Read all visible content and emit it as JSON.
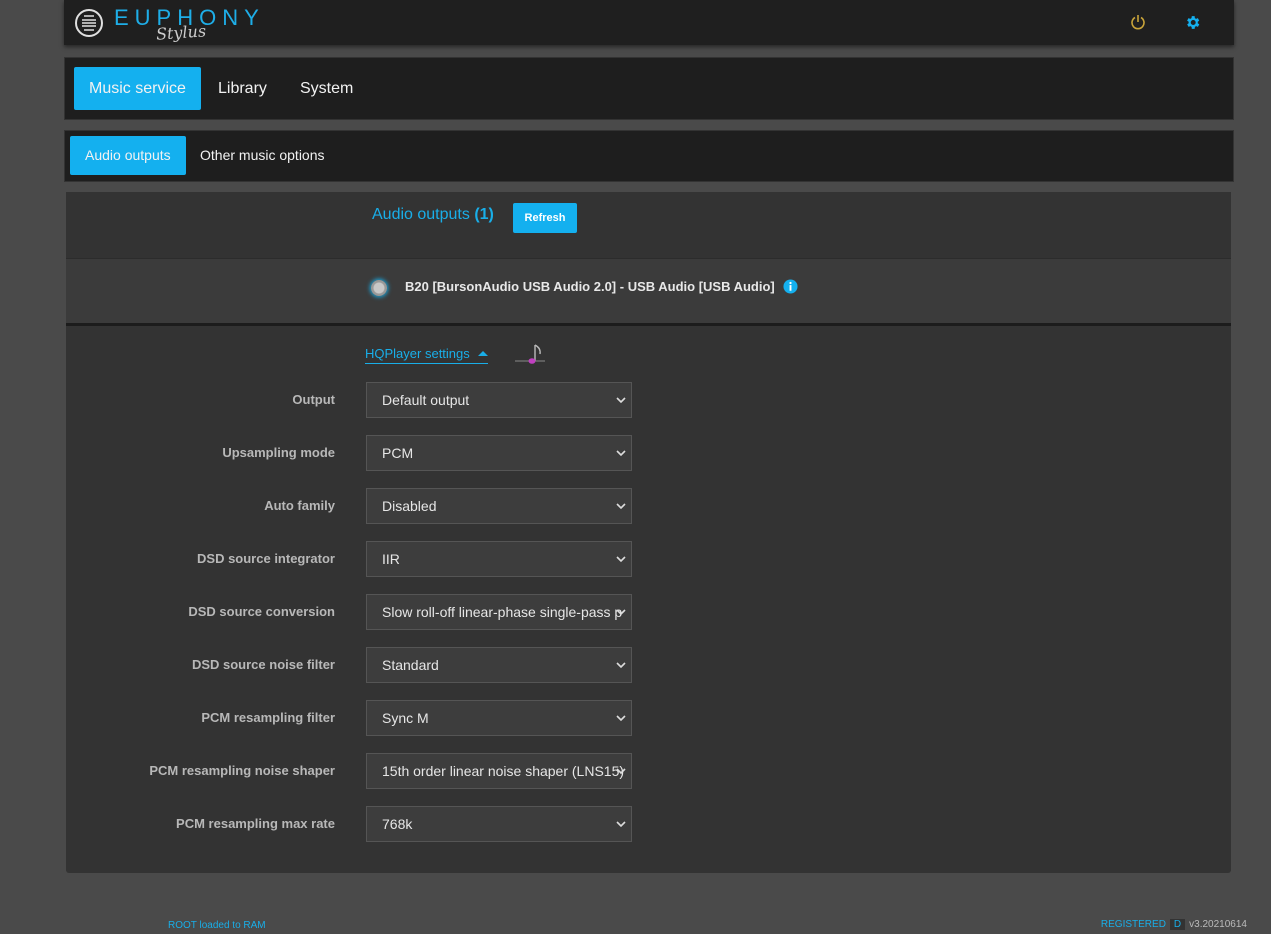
{
  "header": {
    "logo_word": "EUPHONY",
    "logo_script": "Stylus",
    "accent": "#14b0ef"
  },
  "main_tabs": [
    {
      "label": "Music service",
      "active": true
    },
    {
      "label": "Library",
      "active": false
    },
    {
      "label": "System",
      "active": false
    }
  ],
  "sub_tabs": [
    {
      "label": "Audio outputs",
      "active": true
    },
    {
      "label": "Other music options",
      "active": false
    }
  ],
  "outputs": {
    "title": "Audio outputs",
    "count": "(1)",
    "refresh_label": "Refresh",
    "device_name": "B20 [BursonAudio USB Audio 2.0] - USB Audio [USB Audio]"
  },
  "hqplayer": {
    "link_label": "HQPlayer settings",
    "settings": [
      {
        "label": "Output",
        "value": "Default output"
      },
      {
        "label": "Upsampling mode",
        "value": "PCM"
      },
      {
        "label": "Auto family",
        "value": "Disabled"
      },
      {
        "label": "DSD source integrator",
        "value": "IIR"
      },
      {
        "label": "DSD source conversion",
        "value": "Slow roll-off linear-phase single-pass p"
      },
      {
        "label": "DSD source noise filter",
        "value": "Standard"
      },
      {
        "label": "PCM resampling filter",
        "value": "Sync M"
      },
      {
        "label": "PCM resampling noise shaper",
        "value": "15th order linear noise shaper (LNS15)"
      },
      {
        "label": "PCM resampling max rate",
        "value": "768k"
      }
    ]
  },
  "footer": {
    "left": "ROOT loaded to RAM",
    "registered": "REGISTERED",
    "badge": "D",
    "version": "v3.20210614"
  }
}
